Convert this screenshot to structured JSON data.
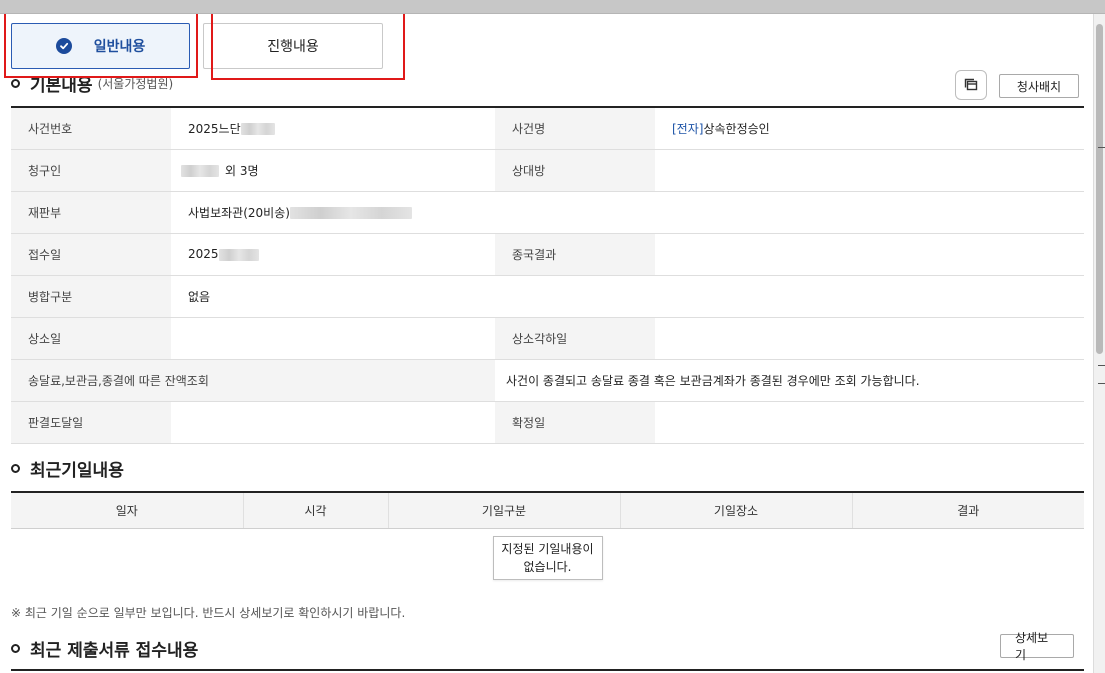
{
  "tabs": {
    "general": "일반내용",
    "progress": "진행내용"
  },
  "basic": {
    "title": "기본내용",
    "court": "(서울가정법원)",
    "assign_button": "청사배치",
    "rows": {
      "case_no_label": "사건번호",
      "case_no_value": "2025느단",
      "case_name_label": "사건명",
      "case_name_tag": "[전자]",
      "case_name_value": "상속한정승인",
      "claimant_label": "청구인",
      "claimant_value": "외 3명",
      "counterparty_label": "상대방",
      "court_label": "재판부",
      "court_value": "사법보좌관(20비송)",
      "received_label": "접수일",
      "received_value": "2025",
      "final_result_label": "종국결과",
      "merge_label": "병합구분",
      "merge_value": "없음",
      "appeal_label": "상소일",
      "appeal_reject_label": "상소각하일",
      "balance_label": "송달료,보관금,종결에 따른 잔액조회",
      "balance_value": "사건이 종결되고 송달료 종결 혹은 보관금계좌가 종결된 경우에만 조회 가능합니다.",
      "judgment_delivery_label": "판결도달일",
      "confirm_label": "확정일"
    }
  },
  "schedule": {
    "title": "최근기일내용",
    "columns": [
      "일자",
      "시각",
      "기일구분",
      "기일장소",
      "결과"
    ],
    "empty_line1": "지정된 기일내용이",
    "empty_line2": "없습니다.",
    "note": "※ 최근 기일 순으로 일부만 보입니다. 반드시 상세보기로 확인하시기 바랍니다."
  },
  "submissions": {
    "title": "최근 제출서류 접수내용",
    "detail_button": "상세보기"
  },
  "colors": {
    "accent": "#1f4f9e",
    "highlight": "#e01919"
  }
}
